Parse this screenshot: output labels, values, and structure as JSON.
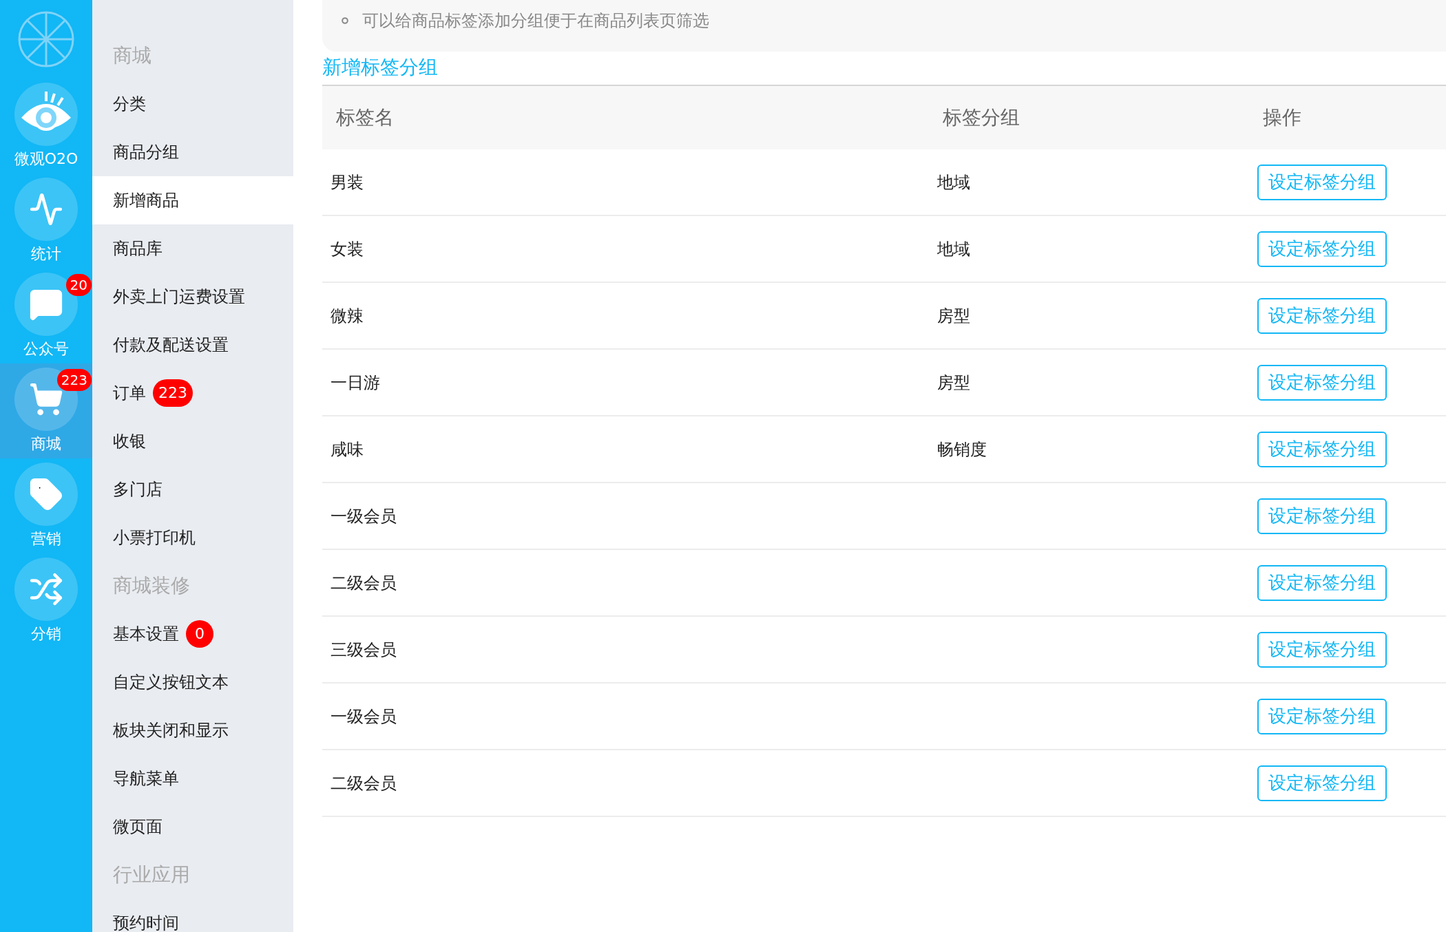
{
  "nav": [
    {
      "label": "微观O2O",
      "kind": "eye",
      "selected": false
    },
    {
      "label": "统计",
      "kind": "pulse",
      "selected": false
    },
    {
      "label": "公众号",
      "kind": "chat",
      "badge": "20",
      "selected": false
    },
    {
      "label": "商城",
      "kind": "cart",
      "badge": "223",
      "selected": true
    },
    {
      "label": "营销",
      "kind": "tag",
      "selected": false
    },
    {
      "label": "分销",
      "kind": "shuffle",
      "selected": false
    }
  ],
  "sidebar": {
    "items": [
      {
        "kind": "header",
        "label": "商城"
      },
      {
        "kind": "item",
        "label": "分类",
        "selected": false
      },
      {
        "kind": "item",
        "label": "商品分组",
        "selected": false
      },
      {
        "kind": "item",
        "label": "新增商品",
        "selected": true
      },
      {
        "kind": "item",
        "label": "商品库",
        "selected": false
      },
      {
        "kind": "item",
        "label": "外卖上门运费设置",
        "selected": false
      },
      {
        "kind": "item",
        "label": "付款及配送设置",
        "selected": false
      },
      {
        "kind": "item",
        "label": "订单",
        "badge": "223",
        "selected": false
      },
      {
        "kind": "item",
        "label": "收银",
        "selected": false
      },
      {
        "kind": "item",
        "label": "多门店",
        "selected": false
      },
      {
        "kind": "item",
        "label": "小票打印机",
        "selected": false
      },
      {
        "kind": "header",
        "label": "商城装修"
      },
      {
        "kind": "item",
        "label": "基本设置",
        "badge": "0",
        "selected": false
      },
      {
        "kind": "item",
        "label": "自定义按钮文本",
        "selected": false
      },
      {
        "kind": "item",
        "label": "板块关闭和显示",
        "selected": false
      },
      {
        "kind": "item",
        "label": "导航菜单",
        "selected": false
      },
      {
        "kind": "item",
        "label": "微页面",
        "selected": false
      },
      {
        "kind": "header",
        "label": "行业应用"
      },
      {
        "kind": "item",
        "label": "预约时间",
        "selected": false
      }
    ]
  },
  "notice": {
    "items": [
      "可以给商品标签添加分组便于在商品列表页筛选"
    ]
  },
  "add_link": "新增标签分组",
  "table": {
    "columns": [
      "标签名",
      "标签分组",
      "操作"
    ],
    "rows": [
      {
        "name": "男装",
        "group": "地域",
        "action": "设定标签分组"
      },
      {
        "name": "女装",
        "group": "地域",
        "action": "设定标签分组"
      },
      {
        "name": "微辣",
        "group": "房型",
        "action": "设定标签分组"
      },
      {
        "name": "一日游",
        "group": "房型",
        "action": "设定标签分组"
      },
      {
        "name": "咸味",
        "group": "畅销度",
        "action": "设定标签分组"
      },
      {
        "name": "一级会员",
        "action": "设定标签分组"
      },
      {
        "name": "二级会员",
        "action": "设定标签分组"
      },
      {
        "name": "三级会员",
        "action": "设定标签分组"
      },
      {
        "name": "一级会员",
        "action": "设定标签分组"
      },
      {
        "name": "二级会员",
        "action": "设定标签分组"
      }
    ]
  }
}
